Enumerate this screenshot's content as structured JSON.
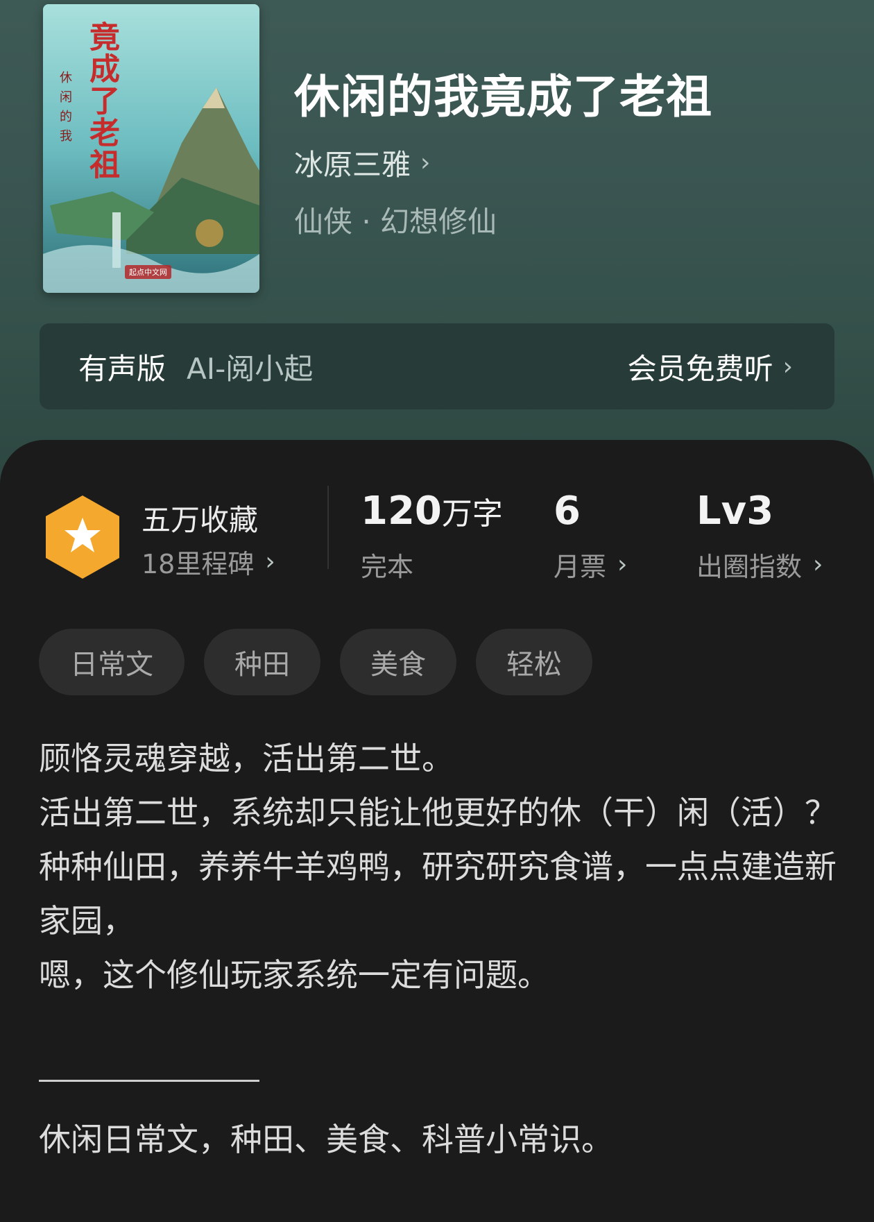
{
  "book": {
    "title": "休闲的我竟成了老祖",
    "author": "冰原三雅",
    "genre": "仙侠 · 幻想修仙",
    "cover": {
      "title_text": "竟成了老祖",
      "subtitle_text": "休闲的我",
      "publisher": "起点中文网"
    }
  },
  "audio": {
    "label": "有声版",
    "narrator": "AI-阅小起",
    "link": "会员免费听"
  },
  "stats": {
    "collection_title": "五万收藏",
    "collection_sub": "18里程碑",
    "words_number": "120",
    "words_unit": "万字",
    "words_status": "完本",
    "monthly_votes": "6",
    "monthly_label": "月票",
    "level": "Lv3",
    "level_label": "出圈指数"
  },
  "tags": [
    "日常文",
    "种田",
    "美食",
    "轻松"
  ],
  "description": [
    "顾恪灵魂穿越，活出第二世。",
    "活出第二世，系统却只能让他更好的休（干）闲（活）？",
    "种种仙田，养养牛羊鸡鸭，研究研究食谱，一点点建造新家园，",
    "嗯，这个修仙玩家系统一定有问题。"
  ],
  "footer_note": "休闲日常文，种田、美食、科普小常识。",
  "colors": {
    "hero_bg": "#3a5551",
    "panel_bg": "#1b1b1b",
    "badge": "#f4a82d",
    "tag_bg": "#2d2d2d"
  }
}
